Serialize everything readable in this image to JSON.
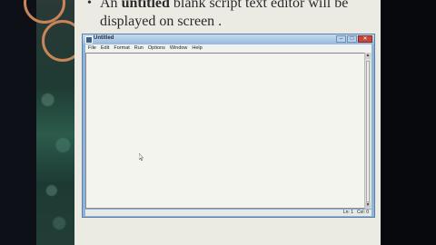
{
  "slide": {
    "bullet": "•",
    "text_before": "An ",
    "text_bold": "untitled",
    "text_after": " blank script text editor will be displayed on screen ."
  },
  "window": {
    "title": "Untitled",
    "controls": {
      "minimize": "–",
      "maximize": "□",
      "close": "✕"
    },
    "menu": [
      "File",
      "Edit",
      "Format",
      "Run",
      "Options",
      "Window",
      "Help"
    ],
    "editor_text": "",
    "status": {
      "line": "Ln: 1",
      "col": "Col: 0"
    }
  },
  "icons": [
    "window-app-icon",
    "scroll-up-arrow-icon",
    "scroll-down-arrow-icon",
    "mouse-cursor-icon"
  ]
}
